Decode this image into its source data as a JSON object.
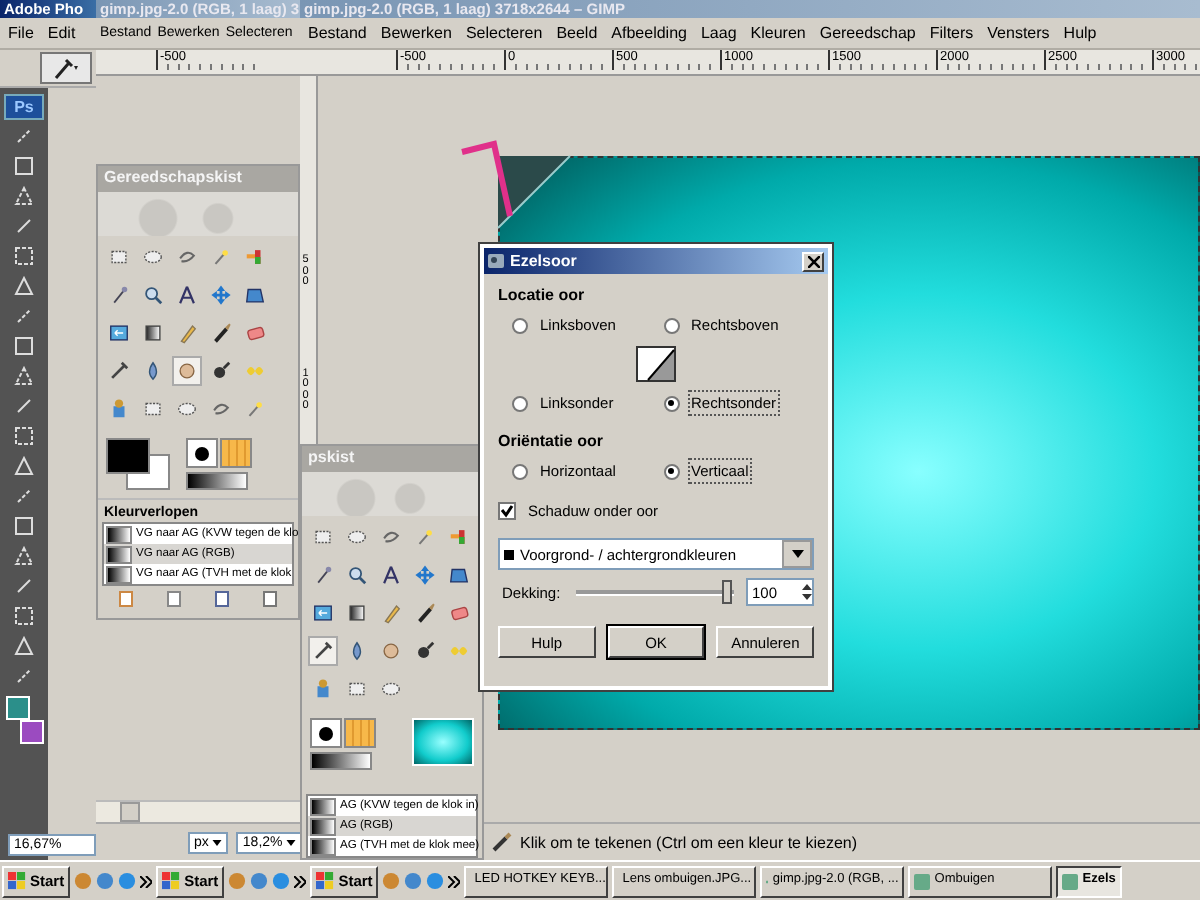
{
  "photoshop": {
    "title": "Adobe Pho",
    "badge": "Ps",
    "menu": [
      "File",
      "Edit"
    ],
    "zoom": "16,67%"
  },
  "gimp_back": {
    "title": "gimp.jpg-2.0 (RGB, 1 laag) 3",
    "menu": [
      "Bestand",
      "Bewerken",
      "Selecteren"
    ],
    "ruler_labels": [
      "-500"
    ],
    "unit": "px",
    "zoom": "18,2%"
  },
  "gimp_front": {
    "title": "gimp.jpg-2.0 (RGB, 1 laag) 3718x2644 – GIMP",
    "menu": [
      "Bestand",
      "Bewerken",
      "Selecteren",
      "Beeld",
      "Afbeelding",
      "Laag",
      "Kleuren",
      "Gereedschap",
      "Filters",
      "Vensters",
      "Hulp"
    ],
    "ruler_labels": [
      "-500",
      "0",
      "500",
      "1000",
      "1500",
      "2000",
      "2500",
      "3000"
    ],
    "vertical_ruler_labels": [
      "500",
      "1000"
    ],
    "status": "Klik om te tekenen (Ctrl om een kleur te kiezen)"
  },
  "toolbox": {
    "title": "Gereedschapskist",
    "tools": [
      {
        "selected": false
      },
      {
        "selected": false
      },
      {
        "selected": false
      },
      {
        "selected": false
      },
      {
        "selected": false
      },
      {
        "selected": false
      },
      {
        "selected": false
      },
      {
        "selected": false
      },
      {
        "selected": false
      },
      {
        "selected": false
      },
      {
        "selected": false
      },
      {
        "selected": false
      },
      {
        "selected": false
      },
      {
        "selected": false
      },
      {
        "selected": false
      },
      {
        "selected": false
      },
      {
        "selected": false
      },
      {
        "selected": true
      },
      {
        "selected": false
      },
      {
        "selected": false
      },
      {
        "selected": false
      },
      {
        "selected": false
      },
      {
        "selected": false
      },
      {
        "selected": false
      },
      {
        "selected": false
      }
    ],
    "gradients_title": "Kleurverlopen",
    "gradients": [
      {
        "label": "VG naar AG (KVW tegen de klo",
        "selected": false
      },
      {
        "label": "VG naar AG (RGB)",
        "selected": true
      },
      {
        "label": "VG naar AG (TVH met de klok",
        "selected": false
      }
    ]
  },
  "toolbox2": {
    "title": "pskist",
    "tools": [
      {
        "selected": false
      },
      {
        "selected": false
      },
      {
        "selected": false
      },
      {
        "selected": false
      },
      {
        "selected": false
      },
      {
        "selected": false
      },
      {
        "selected": false
      },
      {
        "selected": false
      },
      {
        "selected": false
      },
      {
        "selected": false
      },
      {
        "selected": false
      },
      {
        "selected": false
      },
      {
        "selected": false
      },
      {
        "selected": false
      },
      {
        "selected": false
      },
      {
        "selected": true
      },
      {
        "selected": false
      },
      {
        "selected": false
      },
      {
        "selected": false
      },
      {
        "selected": false
      },
      {
        "selected": false
      },
      {
        "selected": false
      },
      {
        "selected": false
      }
    ],
    "gradients": [
      {
        "label": "AG (KVW tegen de klok in)",
        "selected": false
      },
      {
        "label": "AG (RGB)",
        "selected": true
      },
      {
        "label": "AG (TVH met de klok mee)",
        "selected": false
      }
    ]
  },
  "dialog": {
    "title": "Ezelsoor",
    "location_heading": "Locatie oor",
    "locations": [
      {
        "label": "Linksboven",
        "selected": false
      },
      {
        "label": "Rechtsboven",
        "selected": false
      },
      {
        "label": "Linksonder",
        "selected": false
      },
      {
        "label": "Rechtsonder",
        "selected": true
      }
    ],
    "orientation_heading": "Oriëntatie oor",
    "orientations": [
      {
        "label": "Horizontaal",
        "selected": false
      },
      {
        "label": "Verticaal",
        "selected": true
      }
    ],
    "shadow": {
      "label": "Schaduw onder oor",
      "checked": true
    },
    "color_mode": "Voorgrond- / achtergrondkleuren",
    "opacity": {
      "label": "Dekking:",
      "level": 1.0,
      "value": "100"
    },
    "buttons": [
      {
        "label": "Hulp",
        "default": false
      },
      {
        "label": "OK",
        "default": true
      },
      {
        "label": "Annuleren",
        "default": false
      }
    ]
  },
  "taskbar": [
    {
      "kind": "start",
      "label": "Start"
    },
    {
      "kind": "start",
      "label": "Start"
    },
    {
      "kind": "start",
      "label": "Start"
    },
    {
      "kind": "task",
      "label": "LED HOTKEY KEYB...",
      "selected": false
    },
    {
      "kind": "task",
      "label": "Lens ombuigen.JPG...",
      "selected": false
    },
    {
      "kind": "task",
      "label": "gimp.jpg-2.0 (RGB, ...",
      "selected": false
    },
    {
      "kind": "task",
      "label": "Ombuigen",
      "selected": false
    },
    {
      "kind": "task",
      "label": "Ezels",
      "selected": true
    }
  ]
}
